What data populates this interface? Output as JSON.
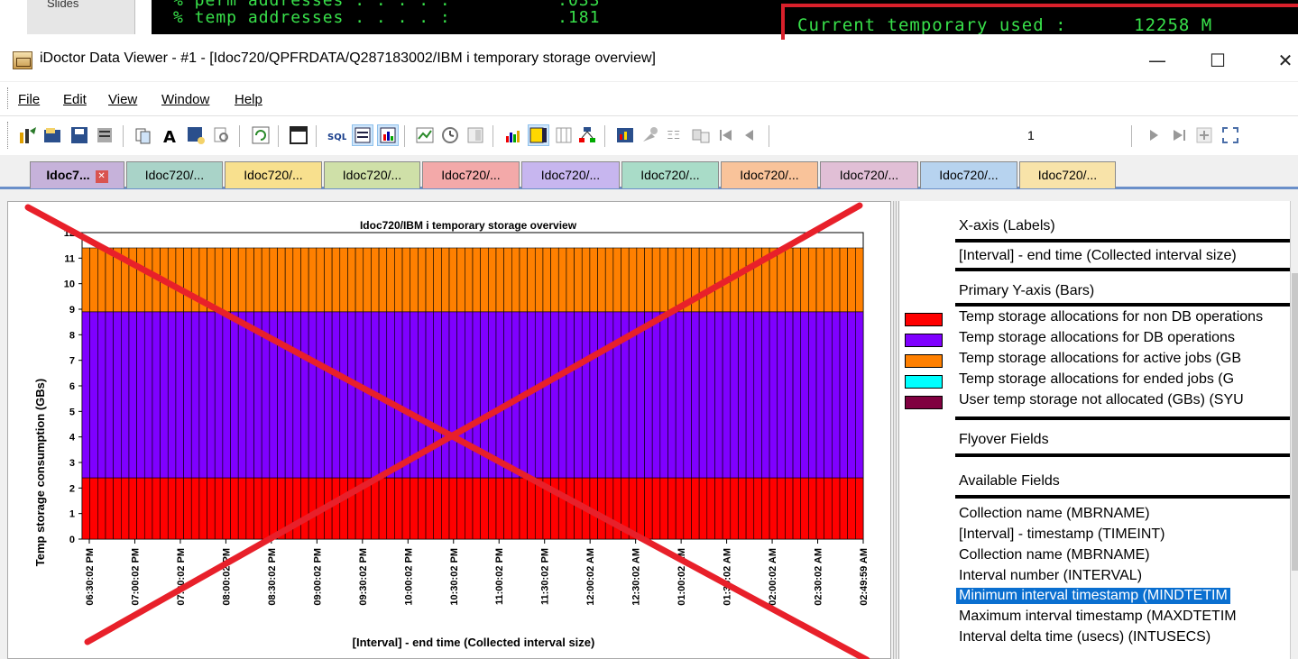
{
  "terminal": {
    "side_tab_label": "Slides",
    "line1": "% perm addresses . . . . :          .033",
    "line2": "% temp addresses . . . . :          .181",
    "highlight_text": "Current temporary used :      12258 M"
  },
  "window": {
    "title": "iDoctor Data Viewer - #1 - [Idoc720/QPFRDATA/Q287183002/IBM i temporary storage overview]",
    "minimize": "—",
    "maximize": "☐",
    "close": "✕"
  },
  "menu": [
    "File",
    "Edit",
    "View",
    "Window",
    "Help"
  ],
  "toolbar": {
    "record_number": "1"
  },
  "tabs": [
    {
      "label": "Idoc7...",
      "color": "#c6b2da",
      "active": true
    },
    {
      "label": "Idoc720/...",
      "color": "#a9d3c8"
    },
    {
      "label": "Idoc720/...",
      "color": "#f8e08e"
    },
    {
      "label": "Idoc720/...",
      "color": "#cfe0a8"
    },
    {
      "label": "Idoc720/...",
      "color": "#f3a9a9"
    },
    {
      "label": "Idoc720/...",
      "color": "#c7b6ef"
    },
    {
      "label": "Idoc720/...",
      "color": "#a9dcc8"
    },
    {
      "label": "Idoc720/...",
      "color": "#f9c39a"
    },
    {
      "label": "Idoc720/...",
      "color": "#e1bfd6"
    },
    {
      "label": "Idoc720/...",
      "color": "#b7d3ef"
    },
    {
      "label": "Idoc720/...",
      "color": "#f8e3a9"
    }
  ],
  "legend_panel": {
    "xaxis_header": "X-axis (Labels)",
    "xaxis_field": "[Interval] - end time (Collected interval size)",
    "yaxis_header": "Primary Y-axis (Bars)",
    "series": [
      {
        "label": "Temp storage allocations for non DB operations",
        "color": "#ff0000"
      },
      {
        "label": "Temp storage allocations for DB operations",
        "color": "#7f00ff"
      },
      {
        "label": "Temp storage allocations for active jobs (GB",
        "color": "#ff8000"
      },
      {
        "label": "Temp storage allocations for ended jobs (G",
        "color": "#00ffff"
      },
      {
        "label": "User temp storage not allocated (GBs) (SYU",
        "color": "#800040"
      }
    ],
    "flyover_header": "Flyover Fields",
    "available_header": "Available Fields",
    "available_fields": [
      "Collection name (MBRNAME)",
      "[Interval] - timestamp (TIMEINT)",
      "Collection name (MBRNAME)",
      "Interval number (INTERVAL)",
      "Minimum interval timestamp (MINDTETIM",
      "Maximum interval timestamp (MAXDTETIM",
      "Interval delta time (usecs) (INTUSECS)"
    ],
    "selected_index": 4
  },
  "chart_data": {
    "type": "bar",
    "stacked": true,
    "title": "Idoc720/IBM i temporary storage overview",
    "xlabel": "[Interval] - end time (Collected interval size)",
    "ylabel": "Temp storage consumption (GBs)",
    "ylim": [
      0,
      12
    ],
    "yticks": [
      0,
      1,
      2,
      3,
      4,
      5,
      6,
      7,
      8,
      9,
      10,
      11,
      12
    ],
    "tick_labels": [
      "06:30:02 PM",
      "07:00:02 PM",
      "07:30:02 PM",
      "08:00:02 PM",
      "08:30:02 PM",
      "09:00:02 PM",
      "09:30:02 PM",
      "10:00:02 PM",
      "10:30:02 PM",
      "11:00:02 PM",
      "11:30:02 PM",
      "12:00:02 AM",
      "12:30:02 AM",
      "01:00:02 AM",
      "01:30:02 AM",
      "02:00:02 AM",
      "02:30:02 AM",
      "02:49:59 AM"
    ],
    "bar_count": 100,
    "series": [
      {
        "name": "Temp storage allocations for non DB operations",
        "color": "#ff0000",
        "value": 2.4
      },
      {
        "name": "Temp storage allocations for DB operations",
        "color": "#7f00ff",
        "value": 6.5
      },
      {
        "name": "Temp storage allocations for active jobs (GB",
        "color": "#ff8000",
        "value": 2.5
      }
    ],
    "overlay": "red-x"
  }
}
